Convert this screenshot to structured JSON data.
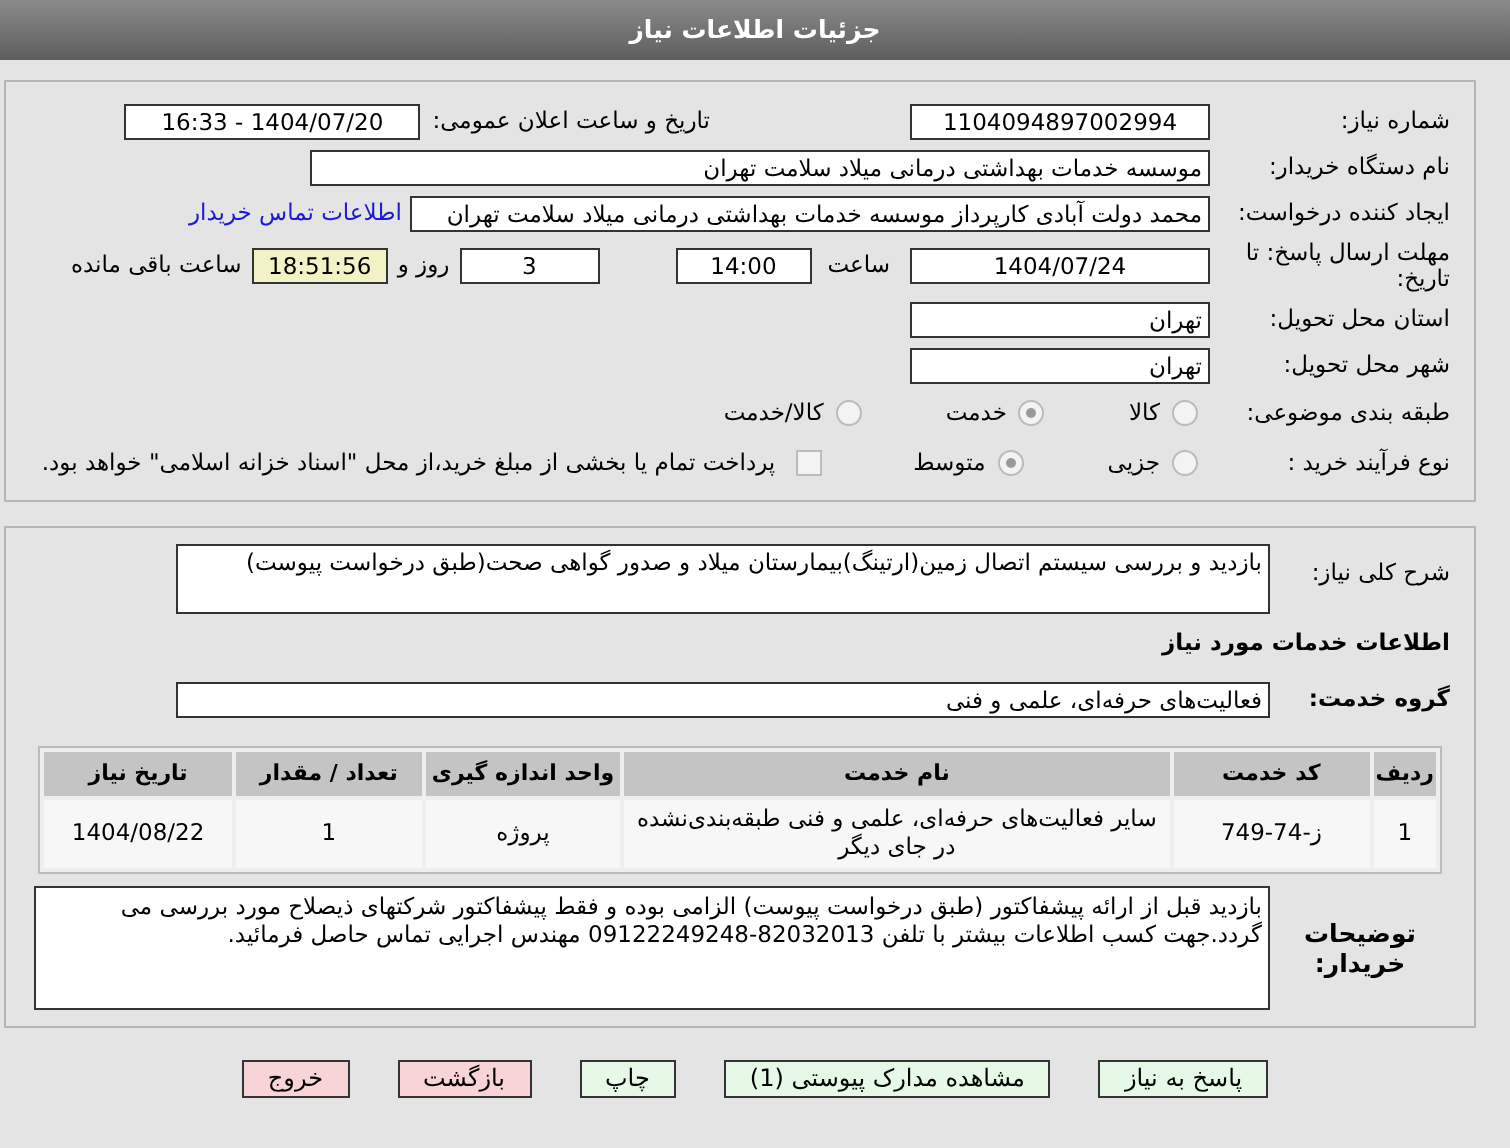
{
  "header": {
    "title": "جزئیات اطلاعات نیاز"
  },
  "need_number": {
    "label": "شماره نیاز:",
    "value": "1104094897002994"
  },
  "announce": {
    "label": "تاریخ و ساعت اعلان عمومی:",
    "value": "1404/07/20 - 16:33"
  },
  "buyer": {
    "label": "نام دستگاه خریدار:",
    "value": "موسسه خدمات بهداشتی درمانی میلاد سلامت تهران"
  },
  "creator": {
    "label": "ایجاد کننده درخواست:",
    "value": "محمد دولت آبادی کارپرداز موسسه خدمات بهداشتی درمانی میلاد سلامت تهران",
    "link": "اطلاعات تماس خریدار"
  },
  "deadline": {
    "label": "مهلت ارسال پاسخ: تا تاریخ:",
    "date": "1404/07/24",
    "time_label": "ساعت",
    "time": "14:00",
    "days": "3",
    "days_label": "روز و",
    "remaining": "18:51:56",
    "remaining_label": "ساعت باقی مانده"
  },
  "province": {
    "label": "استان محل تحویل:",
    "value": "تهران"
  },
  "city": {
    "label": "شهر محل تحویل:",
    "value": "تهران"
  },
  "category": {
    "label": "طبقه بندی موضوعی:",
    "options": [
      {
        "label": "کالا",
        "selected": false
      },
      {
        "label": "خدمت",
        "selected": true
      },
      {
        "label": "کالا/خدمت",
        "selected": false
      }
    ]
  },
  "process": {
    "label": "نوع فرآیند خرید :",
    "options": [
      {
        "label": "جزیی",
        "selected": false
      },
      {
        "label": "متوسط",
        "selected": true
      }
    ],
    "treasury": {
      "checked": false,
      "text": "پرداخت تمام یا بخشی از مبلغ خرید،از محل \"اسناد خزانه اسلامی\" خواهد بود."
    }
  },
  "summary": {
    "label": "شرح کلی نیاز:",
    "value": "بازدید و بررسی سیستم اتصال زمین(ارتینگ)بیمارستان میلاد و صدور گواهی صحت(طبق درخواست پیوست)"
  },
  "services_title": "اطلاعات خدمات مورد نیاز",
  "service_group": {
    "label": "گروه خدمت:",
    "value": "فعالیت‌های حرفه‌ای، علمی و فنی"
  },
  "table": {
    "columns": [
      "ردیف",
      "کد خدمت",
      "نام خدمت",
      "واحد اندازه گیری",
      "تعداد / مقدار",
      "تاریخ نیاز"
    ],
    "rows": [
      [
        "1",
        "ز-74-749",
        "سایر فعالیت‌های حرفه‌ای، علمی و فنی طبقه‌بندی‌نشده در جای دیگر",
        "پروژه",
        "1",
        "1404/08/22"
      ]
    ]
  },
  "notes": {
    "label": "توضیحات خریدار:",
    "value": "بازدید قبل از ارائه پیشفاکتور (طبق درخواست پیوست) الزامی بوده و فقط پیشفاکتور شرکتهای ذیصلاح مورد بررسی می گردد.جهت کسب اطلاعات بیشتر با تلفن 82032013-09122249248 مهندس اجرایی تماس حاصل فرمائید."
  },
  "buttons": [
    {
      "label": "پاسخ به نیاز",
      "kind": "action"
    },
    {
      "label": "مشاهده مدارک پیوستی (1)",
      "kind": "action"
    },
    {
      "label": "چاپ",
      "kind": "action"
    },
    {
      "label": "بازگشت",
      "kind": "exit"
    },
    {
      "label": "خروج",
      "kind": "exit"
    }
  ]
}
